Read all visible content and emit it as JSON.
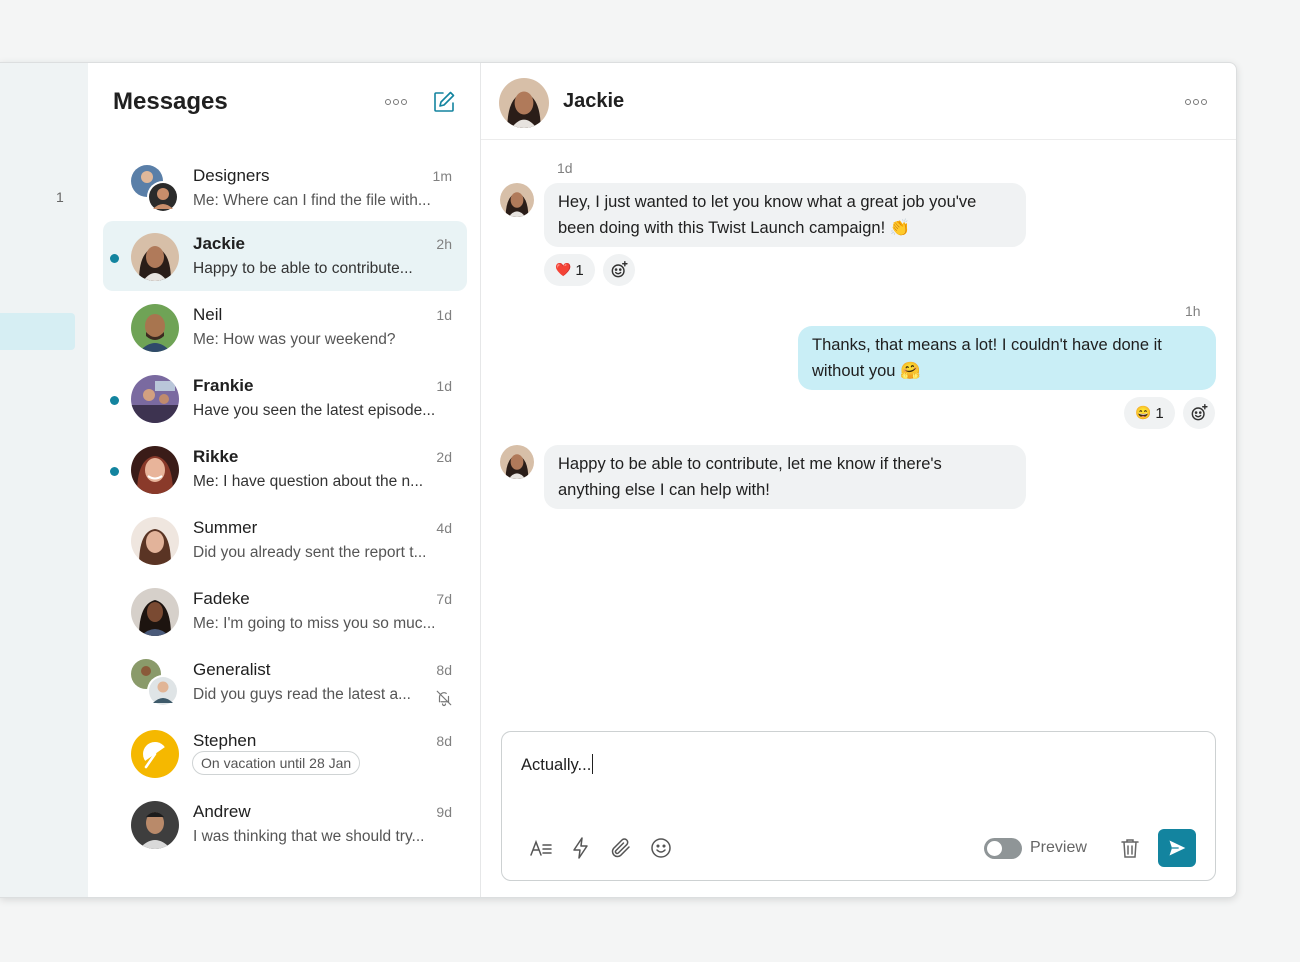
{
  "sidebar": {
    "badge_count": "1"
  },
  "messages_list": {
    "title": "Messages",
    "conversations": [
      {
        "name": "Designers",
        "time": "1m",
        "preview": "Me: Where can I find the file with..."
      },
      {
        "name": "Jackie",
        "time": "2h",
        "preview": "Happy to be able to contribute..."
      },
      {
        "name": "Neil",
        "time": "1d",
        "preview": "Me: How was your weekend?"
      },
      {
        "name": "Frankie",
        "time": "1d",
        "preview": "Have you seen the latest episode..."
      },
      {
        "name": "Rikke",
        "time": "2d",
        "preview": "Me: I have question about the n..."
      },
      {
        "name": "Summer",
        "time": "4d",
        "preview": "Did you already sent the report t..."
      },
      {
        "name": "Fadeke",
        "time": "7d",
        "preview": "Me: I'm going to miss you so muc..."
      },
      {
        "name": "Generalist",
        "time": "8d",
        "preview": "Did you guys read the latest a..."
      },
      {
        "name": "Stephen",
        "time": "8d",
        "status": "On vacation until 28 Jan"
      },
      {
        "name": "Andrew",
        "time": "9d",
        "preview": "I was thinking that we should try..."
      }
    ]
  },
  "chat": {
    "contact_name": "Jackie",
    "messages": [
      {
        "time": "1d",
        "text_line1": "Hey, I just wanted to let you know what a great job you've",
        "text_line2": "been doing with this Twist Launch campaign! 👏",
        "reaction_emoji": "❤️",
        "reaction_count": "1"
      },
      {
        "time": "1h",
        "text_line1": "Thanks, that means a lot! I couldn't have done it",
        "text_line2": "without you 🤗",
        "reaction_emoji": "😄",
        "reaction_count": "1"
      },
      {
        "text_line1": "Happy to be able to contribute, let me know if there's",
        "text_line2": "anything else I can help with!"
      }
    ]
  },
  "composer": {
    "draft": "Actually...",
    "preview_label": "Preview"
  },
  "colors": {
    "accent": "#13849f",
    "own_bubble": "#c9eef6",
    "other_bubble": "#f0f2f3"
  }
}
